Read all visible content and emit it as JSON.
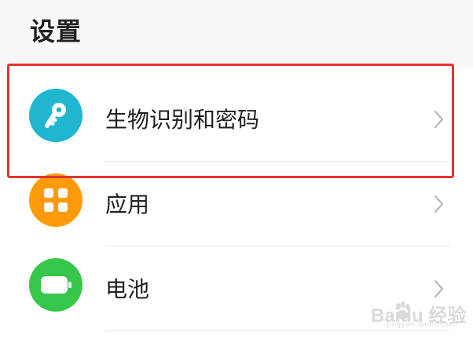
{
  "header": {
    "title": "设置"
  },
  "colors": {
    "background": "#f8f8f8",
    "list_background": "#ffffff",
    "highlight": "#e3342f",
    "biometrics_icon": "#20b6cf",
    "apps_icon": "#ff9a0a",
    "battery_icon": "#35c64a"
  },
  "settings": {
    "items": [
      {
        "label": "生物识别和密码",
        "icon": "key-icon",
        "highlighted": true
      },
      {
        "label": "应用",
        "icon": "apps-grid-icon",
        "highlighted": false
      },
      {
        "label": "电池",
        "icon": "battery-icon",
        "highlighted": false
      }
    ]
  },
  "watermark": {
    "main": "Baidu 经验",
    "sub": "jingyan.baidu.com"
  }
}
